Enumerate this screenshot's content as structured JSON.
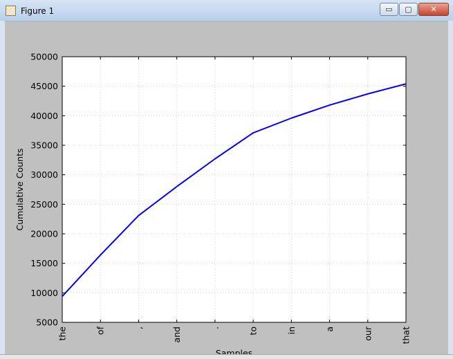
{
  "window": {
    "title": "Figure 1",
    "min_glyph": "▭",
    "max_glyph": "▢",
    "close_glyph": "✕"
  },
  "chart_data": {
    "type": "line",
    "categories": [
      "the",
      "of",
      ",",
      "and",
      ".",
      "to",
      "in",
      "a",
      "our",
      "that"
    ],
    "values": [
      9400,
      16400,
      23100,
      28000,
      32700,
      37100,
      39600,
      41800,
      43700,
      45400
    ],
    "xlabel": "Samples",
    "ylabel": "Cumulative Counts",
    "ylim": [
      5000,
      50000
    ],
    "yticks": [
      5000,
      10000,
      15000,
      20000,
      25000,
      30000,
      35000,
      40000,
      45000,
      50000
    ],
    "grid": true,
    "line_color": "#0000ff",
    "background": "#ffffff"
  }
}
